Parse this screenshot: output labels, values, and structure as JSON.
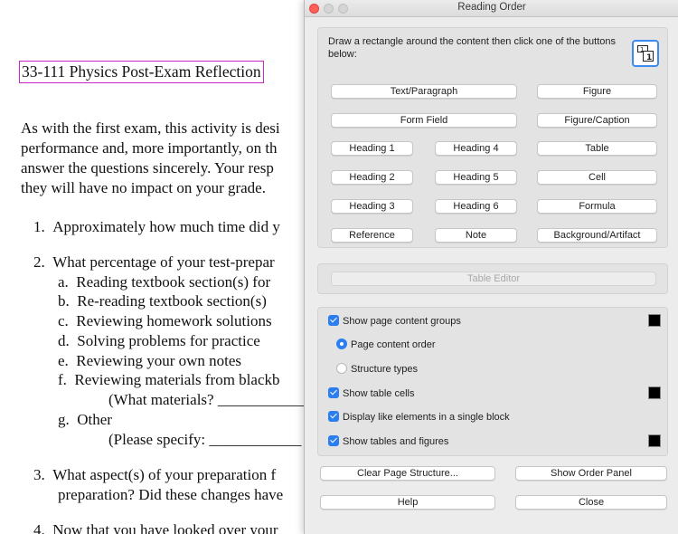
{
  "document": {
    "title": "33-111 Physics Post-Exam Reflection",
    "intro_lines": [
      "As with the first exam, this activity is desi",
      "performance and, more importantly, on th",
      "answer the questions sincerely. Your resp",
      "they will have no impact on your grade."
    ],
    "items": [
      {
        "num": "1.",
        "text": "Approximately how much time did y"
      },
      {
        "num": "2.",
        "text": "What percentage of your test-prepar"
      },
      {
        "num": "a.",
        "text": "Reading textbook section(s) for"
      },
      {
        "num": "b.",
        "text": "Re-reading textbook section(s)"
      },
      {
        "num": "c.",
        "text": "Reviewing homework solutions"
      },
      {
        "num": "d.",
        "text": "Solving problems for practice"
      },
      {
        "num": "e.",
        "text": "Reviewing your own notes"
      },
      {
        "num": "f.",
        "text": "Reviewing materials from blackb"
      },
      {
        "num": "",
        "text": "(What materials? ____________"
      },
      {
        "num": "g.",
        "text": "Other"
      },
      {
        "num": "",
        "text": "(Please specify: ____________"
      },
      {
        "num": "3.",
        "text": "What aspect(s) of your preparation f"
      },
      {
        "num": "",
        "text": "preparation? Did these changes have"
      },
      {
        "num": "4.",
        "text": "Now that you have looked over your"
      }
    ]
  },
  "window": {
    "title": "Reading Order",
    "instructions": "Draw a rectangle around the content then click one of the buttons below:",
    "icon": "reading-order-select-icon",
    "buttons": {
      "text_paragraph": "Text/Paragraph",
      "figure": "Figure",
      "form_field": "Form Field",
      "figure_caption": "Figure/Caption",
      "heading1": "Heading 1",
      "heading4": "Heading 4",
      "table": "Table",
      "heading2": "Heading 2",
      "heading5": "Heading 5",
      "cell": "Cell",
      "heading3": "Heading 3",
      "heading6": "Heading 6",
      "formula": "Formula",
      "reference": "Reference",
      "note": "Note",
      "background_artifact": "Background/Artifact"
    },
    "table_editor": "Table Editor",
    "options": {
      "show_page_content_groups": {
        "label": "Show page content groups",
        "checked": true
      },
      "page_content_order": {
        "label": "Page content order",
        "selected": true
      },
      "structure_types": {
        "label": "Structure types",
        "selected": false
      },
      "show_table_cells": {
        "label": "Show table cells",
        "checked": true
      },
      "display_like_elements": {
        "label": "Display like elements in a single block",
        "checked": true
      },
      "show_tables_and_figures": {
        "label": "Show tables and figures",
        "checked": true
      }
    },
    "footer": {
      "clear_page_structure": "Clear Page Structure...",
      "show_order_panel": "Show Order Panel",
      "help": "Help",
      "close": "Close"
    },
    "colors": {
      "accent": "#2b7ef0",
      "swatch": "#000000",
      "highlight": "#c826c8"
    }
  }
}
